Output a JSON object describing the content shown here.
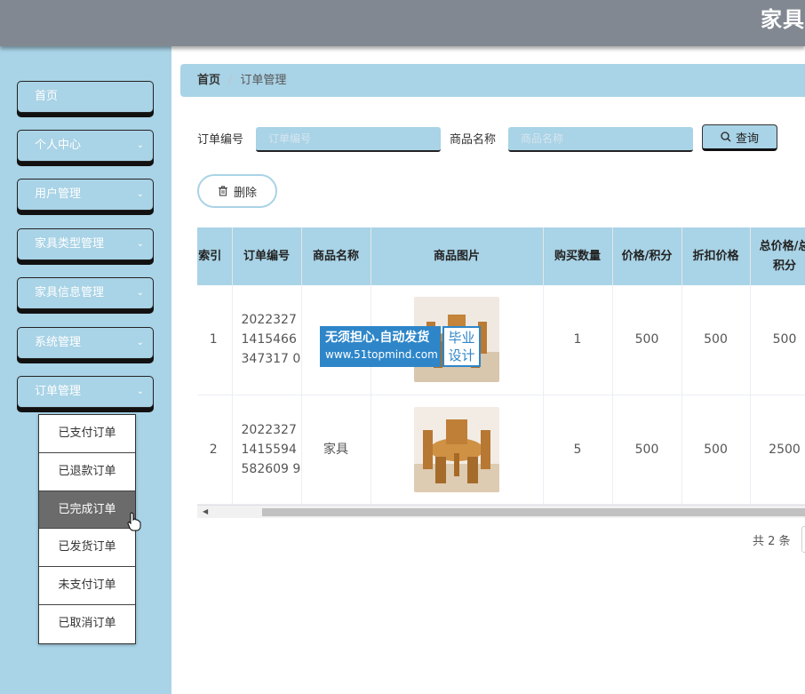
{
  "header": {
    "title": "家具"
  },
  "sidebar": {
    "items": [
      {
        "label": "首页"
      },
      {
        "label": "个人中心"
      },
      {
        "label": "用户管理"
      },
      {
        "label": "家具类型管理"
      },
      {
        "label": "家具信息管理"
      },
      {
        "label": "系统管理"
      },
      {
        "label": "订单管理"
      }
    ],
    "submenu": [
      {
        "label": "已支付订单"
      },
      {
        "label": "已退款订单"
      },
      {
        "label": "已完成订单"
      },
      {
        "label": "已发货订单"
      },
      {
        "label": "未支付订单"
      },
      {
        "label": "已取消订单"
      }
    ]
  },
  "breadcrumb": {
    "home": "首页",
    "separator": "/",
    "current": "订单管理"
  },
  "search": {
    "order_label": "订单编号",
    "order_placeholder": "订单编号",
    "product_label": "商品名称",
    "product_placeholder": "商品名称",
    "query_label": "查询"
  },
  "actions": {
    "delete_label": "删除"
  },
  "table": {
    "headers": {
      "index": "索引",
      "order_no": "订单编号",
      "product_name": "商品名称",
      "product_image": "商品图片",
      "quantity": "购买数量",
      "price": "价格/积分",
      "discount": "折扣价格",
      "total": "总价格/总积分"
    },
    "rows": [
      {
        "index": "1",
        "order_no": "20223271415466347317 0",
        "product_name": "",
        "quantity": "1",
        "price": "500",
        "discount": "500",
        "total": "500"
      },
      {
        "index": "2",
        "order_no": "20223271415594582609 9",
        "product_name": "家具",
        "quantity": "5",
        "price": "500",
        "discount": "500",
        "total": "2500"
      }
    ]
  },
  "watermark": {
    "line1": "无须担心.自动发货",
    "line2": "www.51topmind.com",
    "badge": "毕业设计"
  },
  "pagination": {
    "total_text": "共 2 条"
  },
  "colors": {
    "accent": "#a9d3e6",
    "header": "#818891",
    "active": "#6b6b6b",
    "watermark": "#2e86c9"
  }
}
